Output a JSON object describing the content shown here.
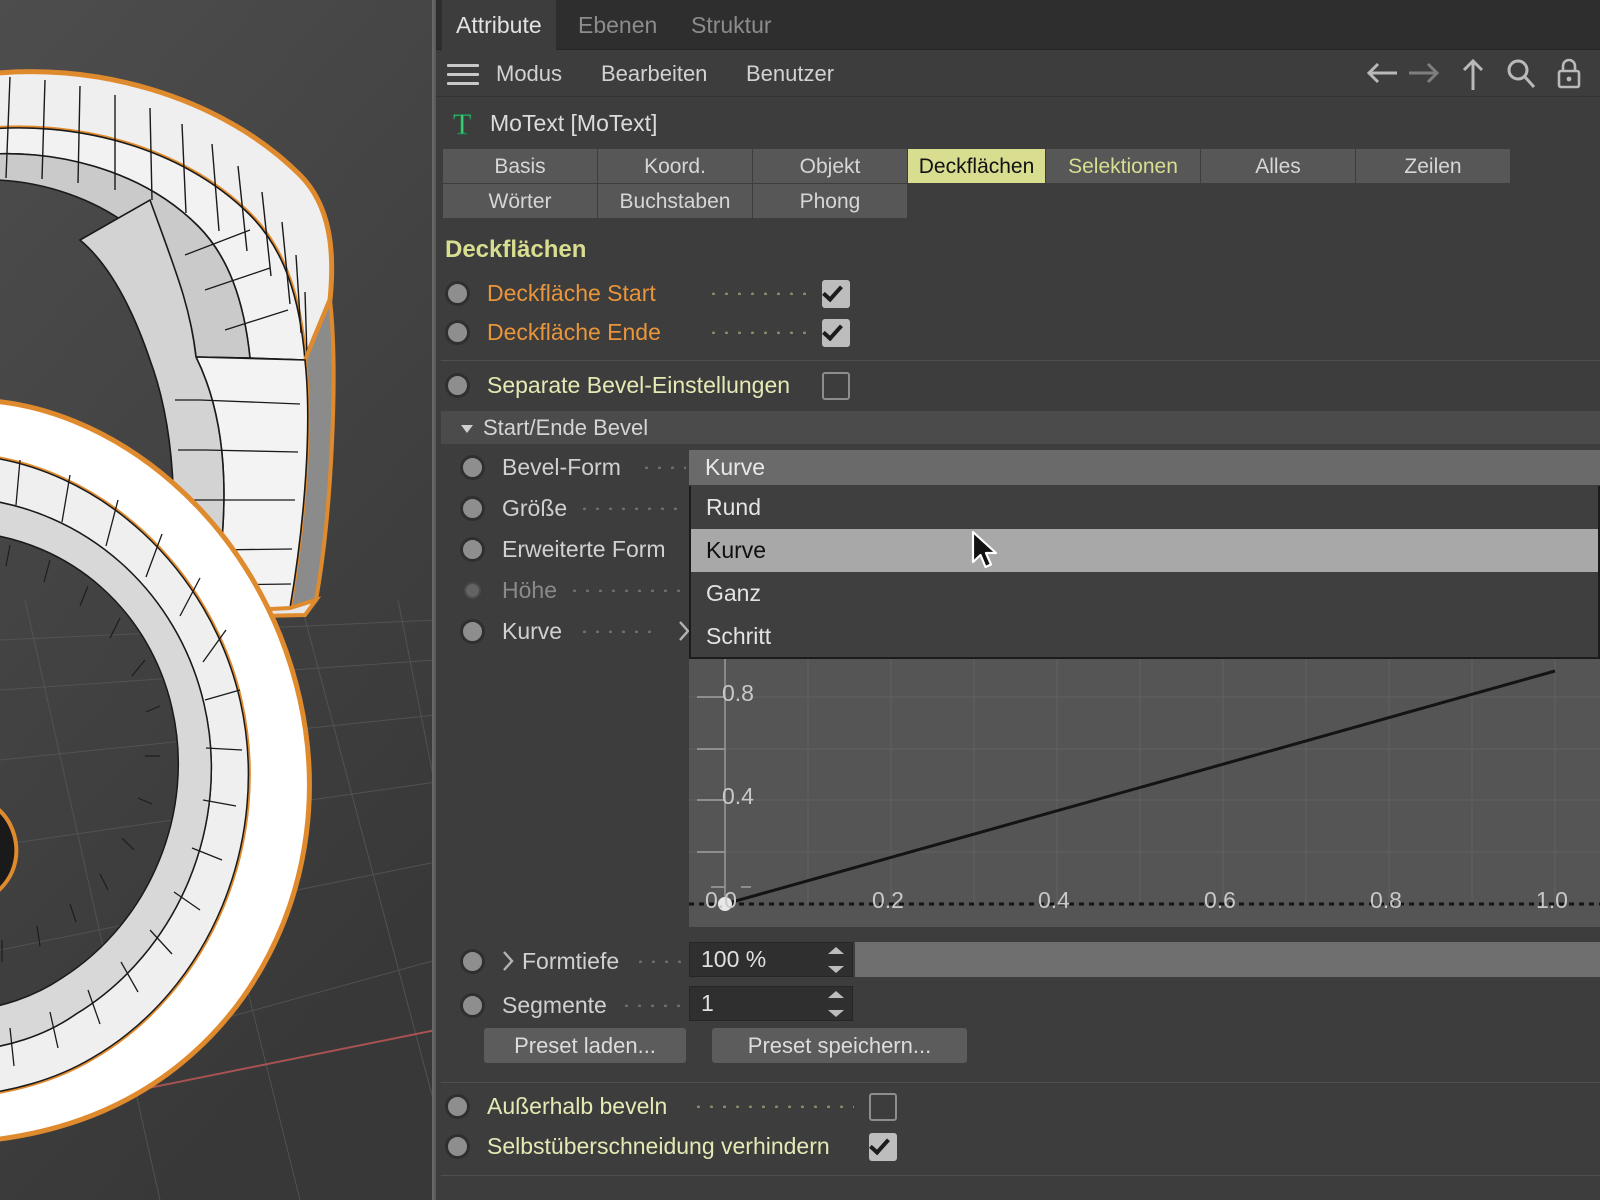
{
  "window_tabs": [
    {
      "label": "Attribute",
      "active": true
    },
    {
      "label": "Ebenen",
      "active": false
    },
    {
      "label": "Struktur",
      "active": false
    }
  ],
  "menubar": {
    "hamburger_icon": "hamburger-icon",
    "items": [
      "Modus",
      "Bearbeiten",
      "Benutzer"
    ],
    "right_icons": [
      "arrow-left-icon",
      "arrow-right-icon",
      "arrow-up-icon",
      "search-icon",
      "lock-icon"
    ]
  },
  "object": {
    "icon": "motext-icon",
    "name": "MoText [MoText]"
  },
  "property_tabs": {
    "row1": [
      {
        "label": "Basis",
        "state": "normal"
      },
      {
        "label": "Koord.",
        "state": "normal"
      },
      {
        "label": "Objekt",
        "state": "normal"
      },
      {
        "label": "Deckflächen",
        "state": "active"
      },
      {
        "label": "Selektionen",
        "state": "highlighted"
      },
      {
        "label": "Alles",
        "state": "normal"
      },
      {
        "label": "Zeilen",
        "state": "normal"
      }
    ],
    "row2": [
      {
        "label": "Wörter",
        "state": "normal"
      },
      {
        "label": "Buchstaben",
        "state": "normal"
      },
      {
        "label": "Phong",
        "state": "normal"
      }
    ]
  },
  "section": {
    "title": "Deckflächen",
    "rows": [
      {
        "label": "Deckfläche Start",
        "checked": true
      },
      {
        "label": "Deckfläche Ende",
        "checked": true
      }
    ],
    "separate_bevel": {
      "label": "Separate Bevel-Einstellungen",
      "checked": false
    }
  },
  "bevel_group": {
    "header": "Start/Ende Bevel",
    "fields": [
      {
        "label": "Bevel-Form",
        "enabled": true
      },
      {
        "label": "Größe",
        "enabled": true
      },
      {
        "label": "Erweiterte Form",
        "enabled": true
      },
      {
        "label": "Höhe",
        "enabled": false
      },
      {
        "label": "Kurve",
        "enabled": true,
        "arrow": "chevron-right-icon"
      }
    ]
  },
  "dropdown": {
    "selected": "Kurve",
    "options": [
      "Rund",
      "Kurve",
      "Ganz",
      "Schritt"
    ],
    "hovered": "Kurve"
  },
  "chart_data": {
    "type": "line",
    "title": "",
    "xlabel": "",
    "ylabel": "",
    "x_ticks": [
      "0.0",
      "0.2",
      "0.4",
      "0.6",
      "0.8",
      "1.0"
    ],
    "y_ticks": [
      "0.4",
      "0.8"
    ],
    "xlim": [
      0,
      1
    ],
    "ylim": [
      0,
      1
    ],
    "grid": true,
    "series": [
      {
        "name": "bevel-curve",
        "x": [
          0.0,
          1.0
        ],
        "y": [
          0.0,
          1.0
        ]
      }
    ],
    "points": [
      {
        "x": 0.0,
        "y": 0.0
      }
    ]
  },
  "bottom_fields": [
    {
      "label": "Formtiefe",
      "value": "100 %",
      "has_slider": true,
      "slider_percent": 100,
      "expander": "chevron-right-icon"
    },
    {
      "label": "Segmente",
      "value": "1",
      "has_slider": false
    }
  ],
  "preset_buttons": [
    {
      "label": "Preset laden..."
    },
    {
      "label": "Preset speichern..."
    }
  ],
  "footer_rows": [
    {
      "label": "Außerhalb beveln",
      "checked": false
    },
    {
      "label": "Selbstüberschneidung verhindern",
      "checked": true
    }
  ],
  "colors": {
    "accent_tab": "#d9dd90",
    "label_orange": "#e8953c",
    "label_khaki": "#e6e9b4",
    "panel_bg": "#3d3d3d",
    "selection_outline": "#e08a2e"
  }
}
